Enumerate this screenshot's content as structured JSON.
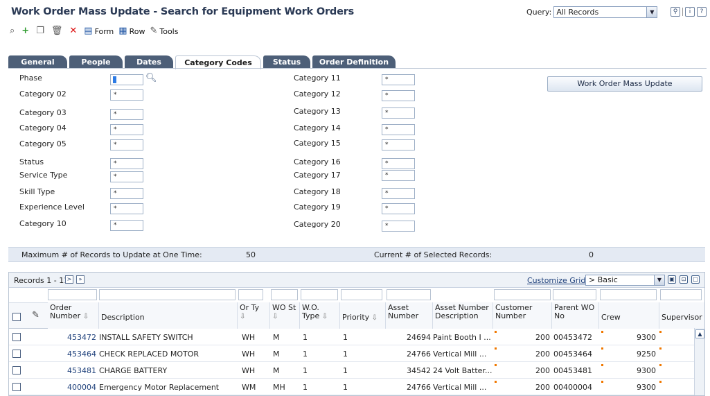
{
  "header": {
    "title": "Work Order Mass Update - Search for Equipment Work Orders",
    "query_label": "Query:",
    "query_value": "All Records"
  },
  "toolbar": {
    "form_label": "Form",
    "row_label": "Row",
    "tools_label": "Tools"
  },
  "tabs": [
    {
      "label": "General"
    },
    {
      "label": "People"
    },
    {
      "label": "Dates"
    },
    {
      "label": "Category Codes"
    },
    {
      "label": "Status"
    },
    {
      "label": "Order Definition"
    }
  ],
  "form": {
    "left": [
      {
        "label": "Phase",
        "value": ""
      },
      {
        "label": "Category 02",
        "value": "*"
      },
      {
        "label": "Category 03",
        "value": "*"
      },
      {
        "label": "Category 04",
        "value": "*"
      },
      {
        "label": "Category 05",
        "value": "*"
      },
      {
        "label": "Status",
        "value": "*"
      },
      {
        "label": "Service Type",
        "value": "*"
      },
      {
        "label": "Skill Type",
        "value": "*"
      },
      {
        "label": "Experience Level",
        "value": "*"
      },
      {
        "label": "Category 10",
        "value": "*"
      }
    ],
    "right": [
      {
        "label": "Category 11",
        "value": "*"
      },
      {
        "label": "Category 12",
        "value": "*"
      },
      {
        "label": "Category 13",
        "value": "*"
      },
      {
        "label": "Category 14",
        "value": "*"
      },
      {
        "label": "Category 15",
        "value": "*"
      },
      {
        "label": "Category 16",
        "value": "*"
      },
      {
        "label": "Category 17",
        "value": "*"
      },
      {
        "label": "Category 18",
        "value": "*"
      },
      {
        "label": "Category 19",
        "value": "*"
      },
      {
        "label": "Category 20",
        "value": "*"
      }
    ],
    "mass_update_button": "Work Order Mass Update"
  },
  "summary": {
    "max_label": "Maximum # of Records to Update at One Time:",
    "max_value": "50",
    "current_label": "Current # of Selected Records:",
    "current_value": "0"
  },
  "grid": {
    "records_label": "Records 1 - 11",
    "customize_label": "Customize Grid",
    "view_value": "> Basic",
    "columns": [
      {
        "label": "Order Number",
        "sort": true
      },
      {
        "label": "Description",
        "sort": false
      },
      {
        "label": "Or Ty",
        "sort": true
      },
      {
        "label": "WO St",
        "sort": true
      },
      {
        "label": "W.O. Type",
        "sort": true
      },
      {
        "label": "Priority",
        "sort": true
      },
      {
        "label": "Asset Number",
        "sort": false
      },
      {
        "label": "Asset Number Description",
        "sort": false
      },
      {
        "label": "Customer Number",
        "sort": false
      },
      {
        "label": "Parent WO No",
        "sort": false
      },
      {
        "label": "Crew",
        "sort": false
      },
      {
        "label": "Supervisor",
        "sort": false
      }
    ],
    "rows": [
      {
        "order": "453472",
        "description": "INSTALL SAFETY SWITCH",
        "or_ty": "WH",
        "wo_st": "M",
        "wo_type": "1",
        "priority": "1",
        "asset_number": "24694",
        "asset_desc": "Paint Booth I ...",
        "customer": "200",
        "parent_wo": "00453472",
        "crew": "9300"
      },
      {
        "order": "453464",
        "description": "CHECK REPLACED MOTOR",
        "or_ty": "WH",
        "wo_st": "M",
        "wo_type": "1",
        "priority": "1",
        "asset_number": "24766",
        "asset_desc": "Vertical Mill ...",
        "customer": "200",
        "parent_wo": "00453464",
        "crew": "9250"
      },
      {
        "order": "453481",
        "description": "CHARGE BATTERY",
        "or_ty": "WH",
        "wo_st": "M",
        "wo_type": "1",
        "priority": "1",
        "asset_number": "34542",
        "asset_desc": "24 Volt Batter...",
        "customer": "200",
        "parent_wo": "00453481",
        "crew": "9300"
      },
      {
        "order": "400004",
        "description": "Emergency Motor Replacement",
        "or_ty": "WM",
        "wo_st": "MH",
        "wo_type": "1",
        "priority": "1",
        "asset_number": "24766",
        "asset_desc": "Vertical Mill ...",
        "customer": "200",
        "parent_wo": "00400004",
        "crew": "9300"
      }
    ]
  },
  "icons": [
    "search-icon",
    "add-icon",
    "copy-icon",
    "trash-icon",
    "delete-icon",
    "form-icon",
    "row-icon",
    "tools-icon",
    "filter-icon",
    "info-icon",
    "help-icon",
    "attachment-icon"
  ]
}
